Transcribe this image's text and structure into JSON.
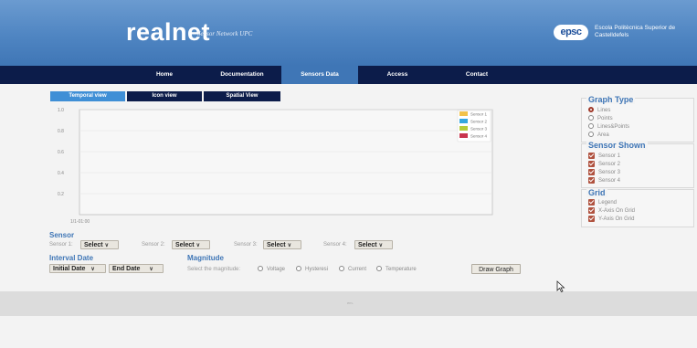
{
  "header": {
    "brand": "realnet",
    "brand_sub": "Sensor Network UPC",
    "logo_text": "epsc",
    "school_name": "Escola Politècnica Superior de Castelldefels"
  },
  "nav": {
    "items": [
      {
        "label": "Home"
      },
      {
        "label": "Documentation"
      },
      {
        "label": "Sensors Data"
      },
      {
        "label": "Access"
      },
      {
        "label": "Contact"
      }
    ],
    "active_index": 2
  },
  "view_tabs": {
    "items": [
      {
        "label": "Temporal view"
      },
      {
        "label": "Icon view"
      },
      {
        "label": "Spatial View"
      }
    ],
    "active_index": 0
  },
  "chart_data": {
    "type": "line",
    "x_tick_labels": [
      "1/1-01:00"
    ],
    "y_ticks": [
      0.2,
      0.4,
      0.6,
      0.8,
      1.0
    ],
    "y_tick_labels": [
      "0.2",
      "0.4",
      "0.6",
      "0.8",
      "1.0"
    ],
    "ylim": [
      0,
      1.0
    ],
    "grid": true,
    "legend_position": "top-right",
    "series": [
      {
        "name": "Sensor 1",
        "color": "#f2c24a",
        "values": []
      },
      {
        "name": "Sensor 2",
        "color": "#35a7e0",
        "values": []
      },
      {
        "name": "Sensor 3",
        "color": "#b6cc3a",
        "values": []
      },
      {
        "name": "Sensor 4",
        "color": "#c9354e",
        "values": []
      }
    ]
  },
  "graph_type": {
    "title": "Graph Type",
    "options": [
      {
        "label": "Lines",
        "selected": true
      },
      {
        "label": "Points",
        "selected": false
      },
      {
        "label": "Lines&Points",
        "selected": false
      },
      {
        "label": "Area",
        "selected": false
      }
    ]
  },
  "sensor_shown": {
    "title": "Sensor Shown",
    "options": [
      {
        "label": "Sensor 1",
        "checked": true
      },
      {
        "label": "Sensor 2",
        "checked": true
      },
      {
        "label": "Sensor 3",
        "checked": true
      },
      {
        "label": "Sensor 4",
        "checked": true
      }
    ]
  },
  "grid": {
    "title": "Grid",
    "options": [
      {
        "label": "Legend",
        "checked": true
      },
      {
        "label": "X-Axis On Grid",
        "checked": true
      },
      {
        "label": "Y-Axis On Grid",
        "checked": true
      }
    ]
  },
  "sensor_section": {
    "title": "Sensor",
    "selects": [
      {
        "label": "Sensor 1:",
        "value": "Select"
      },
      {
        "label": "Sensor 2:",
        "value": "Select"
      },
      {
        "label": "Sensor 3:",
        "value": "Select"
      },
      {
        "label": "Sensor 4:",
        "value": "Select"
      }
    ]
  },
  "interval": {
    "title": "Interval Date",
    "initial": "Initial Date",
    "end": "End Date"
  },
  "magnitude": {
    "title": "Magnitude",
    "prompt": "Select the magnitude:",
    "options": [
      "Voltage",
      "Hysteresi",
      "Current",
      "Temperature"
    ]
  },
  "draw_button": "Draw Graph",
  "footer_text": "em-"
}
